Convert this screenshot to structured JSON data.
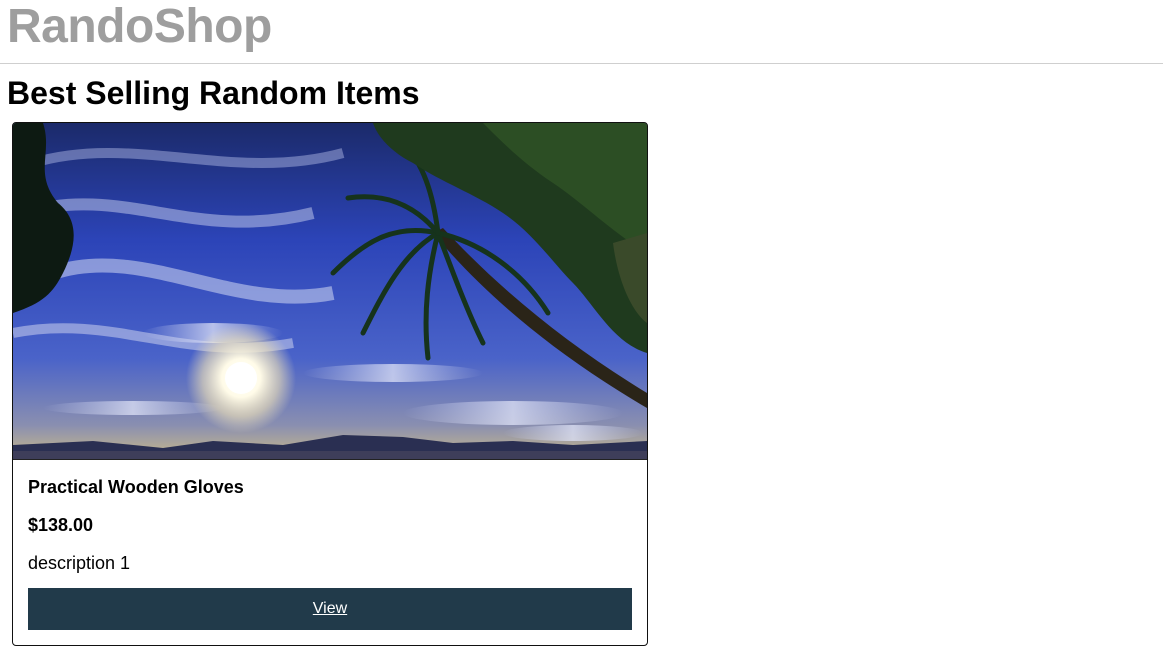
{
  "header": {
    "brand": "RandoShop"
  },
  "main": {
    "section_title": "Best Selling Random Items",
    "products": [
      {
        "name": "Practical Wooden Gloves",
        "price": "$138.00",
        "description": "description 1",
        "view_label": "View",
        "image_alt": "Palm tree under a dramatic sunset sky"
      }
    ]
  },
  "colors": {
    "brand_text": "#9e9e9e",
    "button_bg": "#213a4a",
    "button_text": "#ffffff"
  }
}
